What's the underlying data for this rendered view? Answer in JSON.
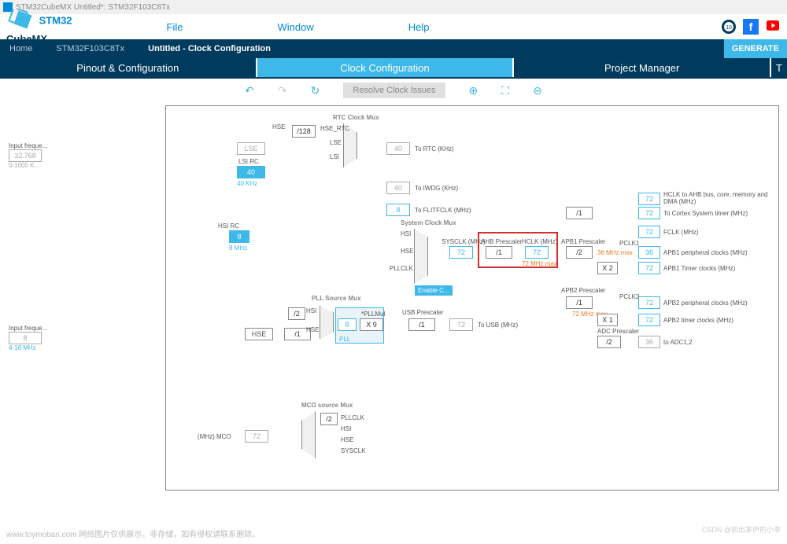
{
  "title_bar": "STM32CubeMX Untitled*: STM32F103C8Tx",
  "logo": {
    "line1": "STM32",
    "line2": "CubeMX"
  },
  "menu": {
    "file": "File",
    "window": "Window",
    "help": "Help"
  },
  "breadcrumb": {
    "home": "Home",
    "chip": "STM32F103C8Tx",
    "current": "Untitled - Clock Configuration"
  },
  "generate_btn": "GENERATE",
  "tabs": {
    "pinout": "Pinout & Configuration",
    "clock": "Clock Configuration",
    "project": "Project Manager",
    "tools": "T"
  },
  "toolbar": {
    "resolve": "Resolve Clock Issues"
  },
  "inputs": {
    "lse_label": "Input freque...",
    "lse_val": "32.768",
    "lse_range": "0-1000 K...",
    "hse_label": "Input freque...",
    "hse_val": "8",
    "hse_range": "4-16 MHz"
  },
  "blocks": {
    "lse": "LSE",
    "lsi_rc": "LSI RC",
    "lsi_val": "40",
    "lsi_unit": "40 KHz",
    "hsi_rc": "HSI RC",
    "hsi_val": "8",
    "hsi_unit": "8 MHz",
    "hse": "HSE",
    "div128": "/128",
    "rtc_out": "40",
    "rtc_lbl": "To RTC (KHz)",
    "iwdg_out": "40",
    "iwdg_lbl": "To IWDG (KHz)",
    "flitf_val": "8",
    "flitf_lbl": "To FLITFCLK (MHz)",
    "hse_rts": "HSE_RTC",
    "lse_mux": "LSE",
    "lsi_mux": "LSI",
    "hsi_mux": "HSI",
    "hse_mux": "HSE",
    "pllclk_mux": "PLLCLK",
    "enable": "Enable C...",
    "sysclk_lbl": "SYSCLK (MHz)",
    "sysclk_val": "72",
    "ahb_lbl": "AHB Prescaler",
    "ahb_sel": "/1",
    "hclk_lbl": "HCLK (MHz)",
    "hclk_val": "72",
    "hclk_max": "72 MHz max",
    "apb1_lbl": "APB1 Prescaler",
    "apb1_sel": "/2",
    "apb1_max": "36 MHz max",
    "apb2_lbl": "APB2 Prescaler",
    "apb2_sel": "/1",
    "apb2_max": "72 MHz max",
    "usb_lbl": "USB Prescaler",
    "usb_sel": "/1",
    "usb_out": "72",
    "usb_to": "To USB (MHz)",
    "pll_src": "PLL Source Mux",
    "pll_hsi": "HSI",
    "pll_hse": "HSE",
    "pll_div": "/2",
    "hse_div": "/1",
    "pll_area": "PLL",
    "pll_mul_lbl": "*PLLMul",
    "pll_in": "8",
    "pll_mul": "X 9",
    "sys_mux": "System Clock Mux",
    "rtc_mux": "RTC Clock Mux",
    "mco_mux": "MCO source Mux",
    "mco_div": "/2",
    "mco_pllclk": "PLLCLK",
    "mco_hsi": "HSI",
    "mco_hse": "HSE",
    "mco_sysclk": "SYSCLK",
    "mco_lbl": "(MHz) MCO",
    "mco_out": "72",
    "x2": "X 2",
    "x1": "X 1",
    "adc_lbl": "ADC Prescaler",
    "adc_sel": "/2",
    "adc_out": "36",
    "adc_to": "to ADC1,2",
    "pclk1": "PCLK1",
    "pclk2": "PCLK2",
    "sys_sel": "/1"
  },
  "outputs": {
    "hclk_ahb": {
      "val": "72",
      "lbl": "HCLK to AHB bus, core, memory and DMA (MHz)"
    },
    "cortex": {
      "val": "72",
      "lbl": "To Cortex System timer (MHz)"
    },
    "fclk": {
      "val": "72",
      "lbl": "FCLK (MHz)"
    },
    "apb1_per": {
      "val": "36",
      "lbl": "APB1 peripheral clocks (MHz)"
    },
    "apb1_tim": {
      "val": "72",
      "lbl": "APB1 Timer clocks (MHz)"
    },
    "apb2_per": {
      "val": "72",
      "lbl": "APB2 peripheral clocks (MHz)"
    },
    "apb2_tim": {
      "val": "72",
      "lbl": "APB2 timer clocks (MHz)"
    }
  },
  "watermark": "www.toymoban.com  网络图片仅供展示，非存储，如有侵权请联系删除。",
  "csdn": "CSDN @初出茅庐的小李"
}
